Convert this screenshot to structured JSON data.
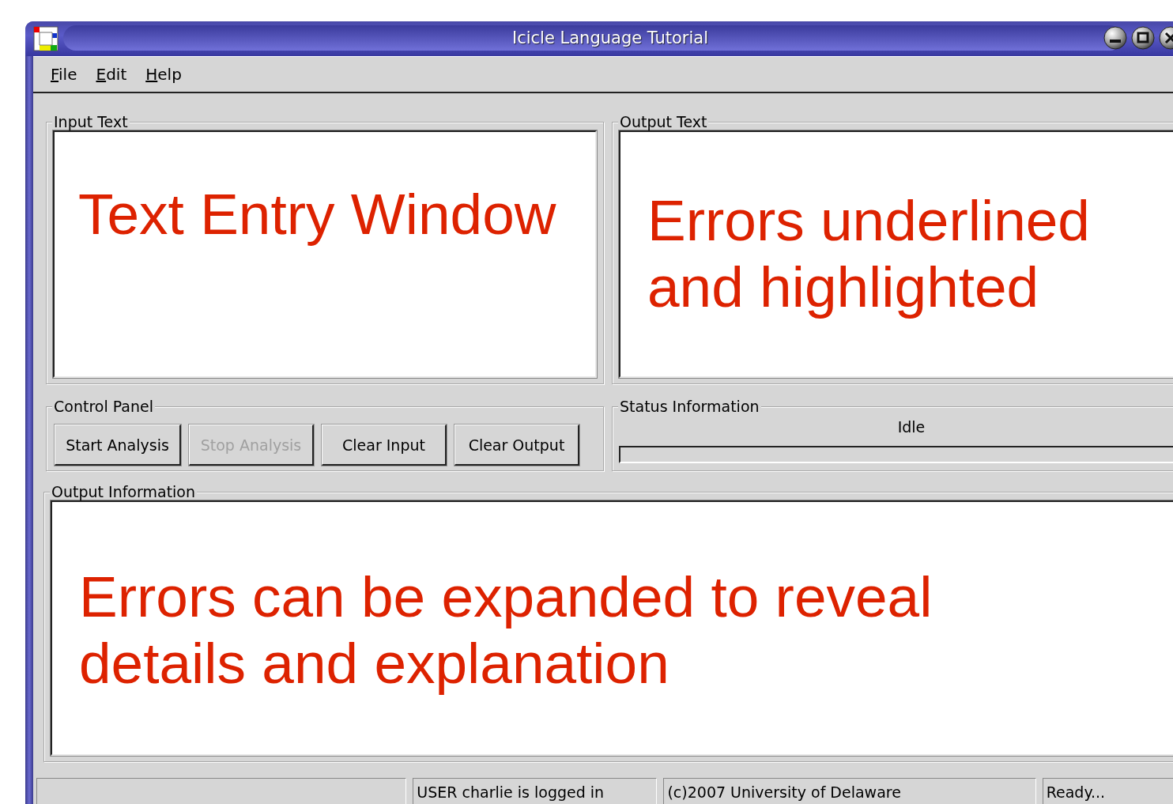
{
  "window": {
    "title": "Icicle Language Tutorial"
  },
  "menu": [
    {
      "label": "File"
    },
    {
      "label": "Edit"
    },
    {
      "label": "Help"
    }
  ],
  "input_text": {
    "label": "Input Text",
    "value": "Text Entry Window"
  },
  "output_text": {
    "label": "Output Text",
    "value": "Errors underlined and highlighted"
  },
  "control_panel": {
    "label": "Control Panel",
    "buttons": [
      {
        "label": "Start Analysis",
        "disabled": false
      },
      {
        "label": "Stop Analysis",
        "disabled": true
      },
      {
        "label": "Clear Input",
        "disabled": false
      },
      {
        "label": "Clear Output",
        "disabled": false
      }
    ]
  },
  "status_information": {
    "label": "Status Information",
    "state": "Idle",
    "progress": {
      "level": 0
    }
  },
  "output_information": {
    "label": "Output Information",
    "value": "Errors can be expanded to reveal details and explanation"
  },
  "status_bar": {
    "cells": [
      "USER charlie is logged in",
      "(c)2007 University of Delaware",
      "Ready..."
    ]
  }
}
